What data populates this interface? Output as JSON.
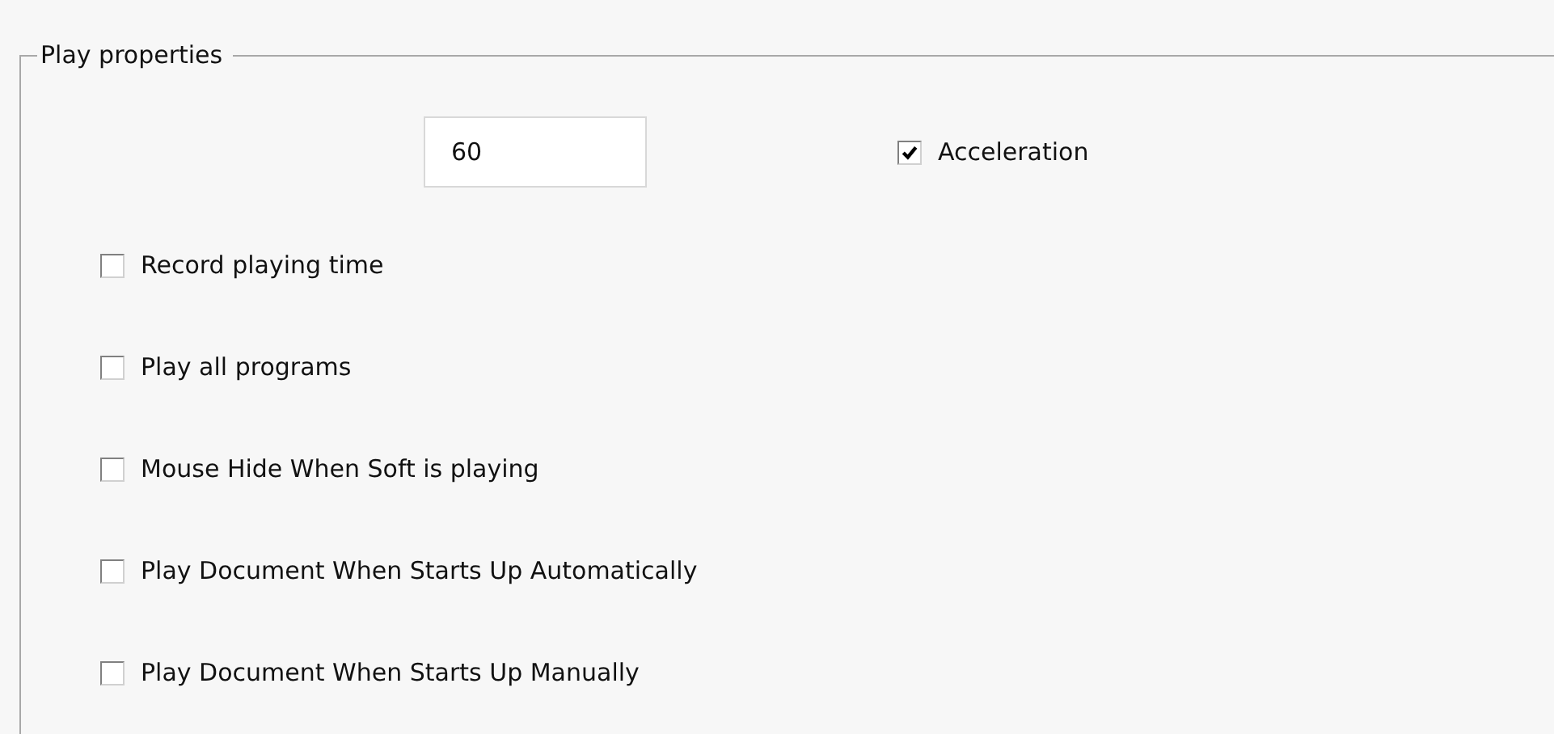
{
  "group": {
    "title": "Play properties"
  },
  "speed_field": {
    "value": "60"
  },
  "acceleration": {
    "label": "Acceleration",
    "checked": true
  },
  "options": [
    {
      "label": "Record playing time",
      "checked": false
    },
    {
      "label": "Play all programs",
      "checked": false
    },
    {
      "label": "Mouse Hide When Soft is playing",
      "checked": false
    },
    {
      "label": "Play Document When Starts Up Automatically",
      "checked": false
    },
    {
      "label": "Play Document When Starts Up Manually",
      "checked": false
    }
  ]
}
